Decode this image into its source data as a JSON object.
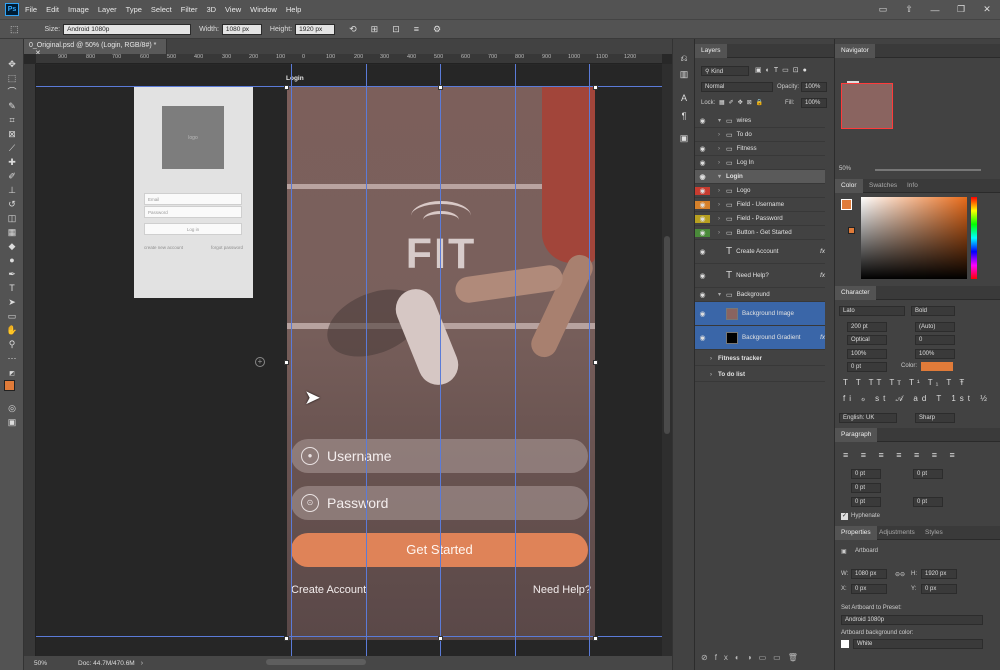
{
  "menubar": {
    "items": [
      "File",
      "Edit",
      "Image",
      "Layer",
      "Type",
      "Select",
      "Filter",
      "3D",
      "View",
      "Window",
      "Help"
    ]
  },
  "options": {
    "size_label": "Size:",
    "size_value": "Android 1080p",
    "width_label": "Width:",
    "width_value": "1080 px",
    "height_label": "Height:",
    "height_value": "1920 px"
  },
  "document": {
    "tab_title": "0_Original.psd @ 50% (Login, RGB/8#) *",
    "zoom": "50%",
    "doc_info": "Doc: 44.7M/470.6M",
    "ruler_ticks": [
      "900",
      "800",
      "700",
      "600",
      "500",
      "400",
      "300",
      "200",
      "100",
      "0",
      "100",
      "200",
      "300",
      "400",
      "500",
      "600",
      "700",
      "800",
      "900",
      "1000",
      "1100",
      "1200"
    ]
  },
  "wires_artboard": {
    "logo": "logo",
    "email_placeholder": "Email",
    "password_placeholder": "Password",
    "login_button": "Log in",
    "create_account": "create new account",
    "forgot_password": "forgot password"
  },
  "login_artboard": {
    "label": "Login",
    "brand": "FIT",
    "username_placeholder": "Username",
    "password_placeholder": "Password",
    "get_started": "Get Started",
    "create_account": "Create Account",
    "need_help": "Need Help?"
  },
  "layers": {
    "title": "Layers",
    "filter": "Kind",
    "blend_mode": "Normal",
    "opacity_label": "Opacity:",
    "opacity": "100%",
    "lock_label": "Lock:",
    "fill_label": "Fill:",
    "fill": "100%",
    "rows": [
      {
        "name": "wires"
      },
      {
        "name": "To do"
      },
      {
        "name": "Fitness"
      },
      {
        "name": "Log In"
      },
      {
        "name": "Login"
      },
      {
        "name": "Logo"
      },
      {
        "name": "Field - Username"
      },
      {
        "name": "Field - Password"
      },
      {
        "name": "Button - Get Started"
      },
      {
        "name": "Create Account"
      },
      {
        "name": "Need Help?"
      },
      {
        "name": "Background"
      },
      {
        "name": "Background Image"
      },
      {
        "name": "Background Gradient"
      },
      {
        "name": "Fitness tracker"
      },
      {
        "name": "To do list"
      }
    ],
    "colors": {
      "red": "#c83c30",
      "orange": "#d5802a",
      "yellow": "#b8a020",
      "green": "#4a8a3a",
      "blue": "#3a66a8"
    }
  },
  "navigator": {
    "title": "Navigator",
    "zoom": "50%"
  },
  "color_panel": {
    "tabs": [
      "Color",
      "Swatches",
      "Info"
    ],
    "foreground": "#e07b39",
    "background": "#ffffff"
  },
  "character": {
    "title": "Character",
    "font": "Lato",
    "style": "Bold",
    "size": "200 pt",
    "leading": "(Auto)",
    "kerning": "Optical",
    "tracking": "0",
    "vscale": "100%",
    "hscale": "100%",
    "baseline": "0 pt",
    "color_label": "Color:",
    "text_color": "#e07b39",
    "language": "English: UK",
    "aa": "Sharp"
  },
  "paragraph": {
    "title": "Paragraph",
    "indent_left": "0 pt",
    "indent_right": "0 pt",
    "first_line": "0 pt",
    "space_before": "0 pt",
    "space_after": "0 pt",
    "hyphenate": "Hyphenate"
  },
  "properties": {
    "tabs": [
      "Properties",
      "Adjustments",
      "Styles"
    ],
    "type": "Artboard",
    "w_label": "W:",
    "w": "1080 px",
    "h_label": "H:",
    "h": "1920 px",
    "x_label": "X:",
    "x": "0 px",
    "y_label": "Y:",
    "y": "0 px",
    "preset_label": "Set Artboard to Preset:",
    "preset": "Android 1080p",
    "bg_label": "Artboard background color:",
    "bg": "White"
  }
}
